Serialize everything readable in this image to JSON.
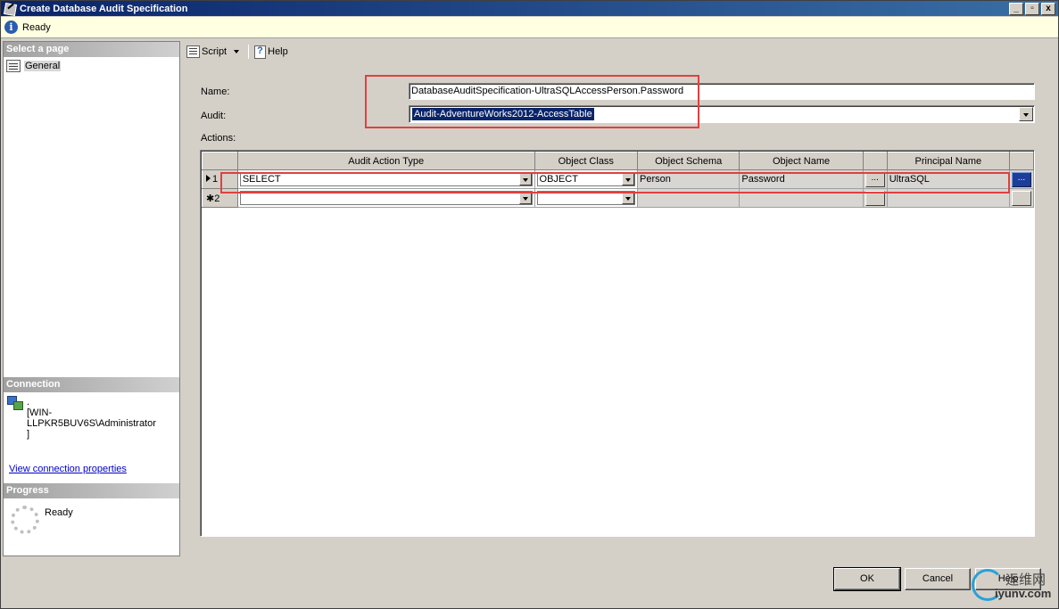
{
  "window": {
    "title": "Create Database Audit Specification",
    "buttons": [
      "_",
      "▫",
      "x"
    ]
  },
  "status": {
    "text": "Ready"
  },
  "left": {
    "select_page_header": "Select a page",
    "pages": [
      {
        "label": "General"
      }
    ],
    "connection_header": "Connection",
    "connection_text": ".\n[WIN-LLPKR5BUV6S\\Administrator\n]",
    "connection_link": "View connection properties",
    "progress_header": "Progress",
    "progress_text": "Ready"
  },
  "toolbar": {
    "script_label": "Script",
    "help_label": "Help"
  },
  "form": {
    "name_label": "Name:",
    "name_value": "DatabaseAuditSpecification-UltraSQLAccessPerson.Password",
    "audit_label": "Audit:",
    "audit_value": "Audit-AdventureWorks2012-AccessTable",
    "actions_label": "Actions:"
  },
  "grid": {
    "columns": [
      "Audit Action Type",
      "Object Class",
      "Object Schema",
      "Object Name",
      "",
      "Principal Name",
      ""
    ],
    "rows": [
      {
        "row_label": "1",
        "action_type": "SELECT",
        "object_class": "OBJECT",
        "object_schema": "Person",
        "object_name": "Password",
        "ellipsis": "...",
        "principal_name": "UltraSQL",
        "ellipsis2": "..."
      },
      {
        "row_label": "2",
        "action_type": "",
        "object_class": "",
        "object_schema": "",
        "object_name": "",
        "ellipsis": "",
        "principal_name": "",
        "ellipsis2": ""
      }
    ]
  },
  "buttons": {
    "ok": "OK",
    "cancel": "Cancel",
    "help": "Help"
  },
  "watermark": {
    "line1": "运维网",
    "line2": "iyunv.com"
  },
  "colors": {
    "title_bar": "#0a246a",
    "highlight": "#e04040",
    "selection": "#0a246a",
    "status_bg": "#ffffe1"
  }
}
